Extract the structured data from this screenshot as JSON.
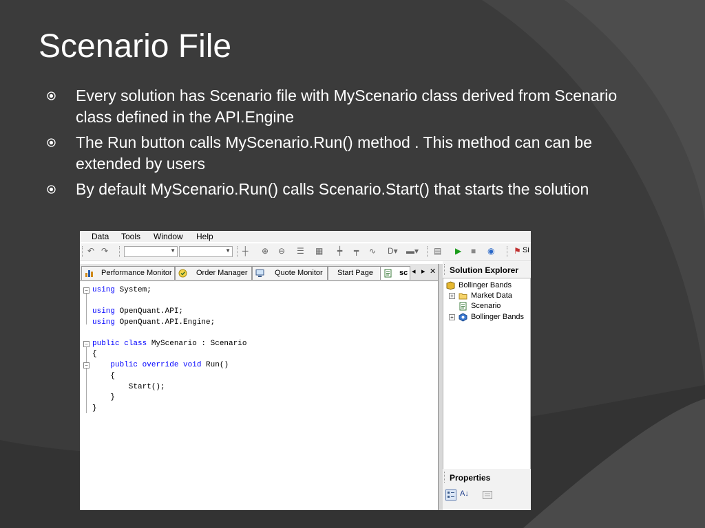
{
  "slide": {
    "title": "Scenario File",
    "bullets": [
      "Every solution has Scenario file with MyScenario class derived from Scenario class defined in the API.Engine",
      "The Run button calls MyScenario.Run() method . This method can can be extended by users",
      "By default MyScenario.Run() calls Scenario.Start() that starts the solution"
    ],
    "colors": {
      "background": "#3b3b3b",
      "text": "#ffffff",
      "keyword": "#0000ff"
    }
  },
  "app": {
    "menu": [
      {
        "label": "Data"
      },
      {
        "label": "Tools"
      },
      {
        "label": "Window"
      },
      {
        "label": "Help"
      }
    ],
    "tabs": [
      {
        "label": "Performance Monitor",
        "icon": "chart-icon"
      },
      {
        "label": "Order Manager",
        "icon": "order-icon"
      },
      {
        "label": "Quote Monitor",
        "icon": "monitor-icon"
      },
      {
        "label": "Start Page",
        "icon": ""
      },
      {
        "label": "sc",
        "icon": "document-icon"
      }
    ],
    "tab_controls": {
      "left": "◂",
      "right": "▸",
      "close": "✕"
    },
    "code": [
      {
        "kw": "using",
        "rest": " System;"
      },
      {
        "kw": "",
        "rest": ""
      },
      {
        "kw": "using",
        "rest": " OpenQuant.API;"
      },
      {
        "kw": "using",
        "rest": " OpenQuant.API.Engine;"
      },
      {
        "kw": "",
        "rest": ""
      },
      {
        "kw": "public class",
        "rest": " MyScenario : Scenario"
      },
      {
        "kw": "",
        "rest": "{"
      },
      {
        "kw": "    public override void",
        "rest": " Run()"
      },
      {
        "kw": "",
        "rest": "    {"
      },
      {
        "kw": "",
        "rest": "        Start();"
      },
      {
        "kw": "",
        "rest": "    }"
      },
      {
        "kw": "",
        "rest": "}"
      }
    ],
    "solution_explorer": {
      "title": "Solution Explorer",
      "items": [
        {
          "label": "Bollinger Bands",
          "icon": "solution-icon"
        },
        {
          "label": "Market Data",
          "icon": "folder-icon"
        },
        {
          "label": "Scenario",
          "icon": "document-icon"
        },
        {
          "label": "Bollinger Bands",
          "icon": "strategy-icon"
        }
      ]
    },
    "properties": {
      "title": "Properties",
      "sort_icon": "sort-az-icon"
    },
    "toolbar_tail": "Si"
  }
}
